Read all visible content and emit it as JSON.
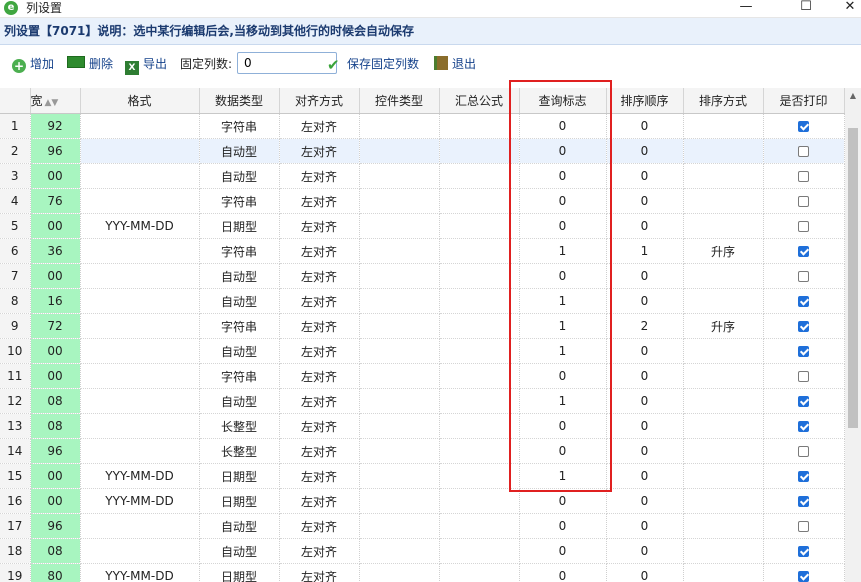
{
  "window": {
    "app_icon": "e",
    "title": "列设置",
    "controls": {
      "minimize": "—",
      "maximize": "☐",
      "close": "✕"
    }
  },
  "info": {
    "text": "列设置【7071】说明：选中某行编辑后会,当移动到其他行的时候会自动保存"
  },
  "toolbar": {
    "add_label": "增加",
    "delete_label": "删除",
    "export_label": "导出",
    "fixed_cols_label": "固定列数:",
    "fixed_cols_value": "0",
    "save_fixed_label": "保存固定列数",
    "exit_label": "退出",
    "icons": [
      "add-icon",
      "delete-icon",
      "export-excel-icon",
      "checkmark-icon",
      "exit-icon"
    ]
  },
  "grid": {
    "columns": [
      "宽",
      "格式",
      "数据类型",
      "对齐方式",
      "控件类型",
      "汇总公式",
      "查询标志",
      "排序顺序",
      "排序方式",
      "是否打印"
    ],
    "selected_row": 2,
    "rows": [
      {
        "num": "1",
        "w": "92",
        "fmt": "",
        "type": "字符串",
        "align": "左对齐",
        "ctrl": "",
        "sum": "",
        "query": "0",
        "order": "0",
        "sort": "",
        "print": true
      },
      {
        "num": "2",
        "w": "96",
        "fmt": "",
        "type": "自动型",
        "align": "左对齐",
        "ctrl": "",
        "sum": "",
        "query": "0",
        "order": "0",
        "sort": "",
        "print": false
      },
      {
        "num": "3",
        "w": "00",
        "fmt": "",
        "type": "自动型",
        "align": "左对齐",
        "ctrl": "",
        "sum": "",
        "query": "0",
        "order": "0",
        "sort": "",
        "print": false
      },
      {
        "num": "4",
        "w": "76",
        "fmt": "",
        "type": "字符串",
        "align": "左对齐",
        "ctrl": "",
        "sum": "",
        "query": "0",
        "order": "0",
        "sort": "",
        "print": false
      },
      {
        "num": "5",
        "w": "00",
        "fmt": "YYY-MM-DD",
        "type": "日期型",
        "align": "左对齐",
        "ctrl": "",
        "sum": "",
        "query": "0",
        "order": "0",
        "sort": "",
        "print": false
      },
      {
        "num": "6",
        "w": "36",
        "fmt": "",
        "type": "字符串",
        "align": "左对齐",
        "ctrl": "",
        "sum": "",
        "query": "1",
        "order": "1",
        "sort": "升序",
        "print": true
      },
      {
        "num": "7",
        "w": "00",
        "fmt": "",
        "type": "自动型",
        "align": "左对齐",
        "ctrl": "",
        "sum": "",
        "query": "0",
        "order": "0",
        "sort": "",
        "print": false
      },
      {
        "num": "8",
        "w": "16",
        "fmt": "",
        "type": "自动型",
        "align": "左对齐",
        "ctrl": "",
        "sum": "",
        "query": "1",
        "order": "0",
        "sort": "",
        "print": true
      },
      {
        "num": "9",
        "w": "72",
        "fmt": "",
        "type": "字符串",
        "align": "左对齐",
        "ctrl": "",
        "sum": "",
        "query": "1",
        "order": "2",
        "sort": "升序",
        "print": true
      },
      {
        "num": "10",
        "w": "00",
        "fmt": "",
        "type": "自动型",
        "align": "左对齐",
        "ctrl": "",
        "sum": "",
        "query": "1",
        "order": "0",
        "sort": "",
        "print": true
      },
      {
        "num": "11",
        "w": "00",
        "fmt": "",
        "type": "字符串",
        "align": "左对齐",
        "ctrl": "",
        "sum": "",
        "query": "0",
        "order": "0",
        "sort": "",
        "print": false
      },
      {
        "num": "12",
        "w": "08",
        "fmt": "",
        "type": "自动型",
        "align": "左对齐",
        "ctrl": "",
        "sum": "",
        "query": "1",
        "order": "0",
        "sort": "",
        "print": true
      },
      {
        "num": "13",
        "w": "08",
        "fmt": "",
        "type": "长整型",
        "align": "左对齐",
        "ctrl": "",
        "sum": "",
        "query": "0",
        "order": "0",
        "sort": "",
        "print": true
      },
      {
        "num": "14",
        "w": "96",
        "fmt": "",
        "type": "长整型",
        "align": "左对齐",
        "ctrl": "",
        "sum": "",
        "query": "0",
        "order": "0",
        "sort": "",
        "print": false
      },
      {
        "num": "15",
        "w": "00",
        "fmt": "YYY-MM-DD",
        "type": "日期型",
        "align": "左对齐",
        "ctrl": "",
        "sum": "",
        "query": "1",
        "order": "0",
        "sort": "",
        "print": true
      },
      {
        "num": "16",
        "w": "00",
        "fmt": "YYY-MM-DD",
        "type": "日期型",
        "align": "左对齐",
        "ctrl": "",
        "sum": "",
        "query": "0",
        "order": "0",
        "sort": "",
        "print": true
      },
      {
        "num": "17",
        "w": "96",
        "fmt": "",
        "type": "自动型",
        "align": "左对齐",
        "ctrl": "",
        "sum": "",
        "query": "0",
        "order": "0",
        "sort": "",
        "print": false
      },
      {
        "num": "18",
        "w": "08",
        "fmt": "",
        "type": "自动型",
        "align": "左对齐",
        "ctrl": "",
        "sum": "",
        "query": "0",
        "order": "0",
        "sort": "",
        "print": true
      },
      {
        "num": "19",
        "w": "80",
        "fmt": "YYY-MM-DD",
        "type": "日期型",
        "align": "左对齐",
        "ctrl": "",
        "sum": "",
        "query": "0",
        "order": "0",
        "sort": "",
        "print": true
      }
    ]
  },
  "annotation": {
    "color": "#e02020",
    "highlighted_column": "查询标志"
  },
  "colors": {
    "width_col": "#a8f5c0",
    "checkbox_checked": "#1f6fd9",
    "selected_row": "#eaf2fd"
  }
}
